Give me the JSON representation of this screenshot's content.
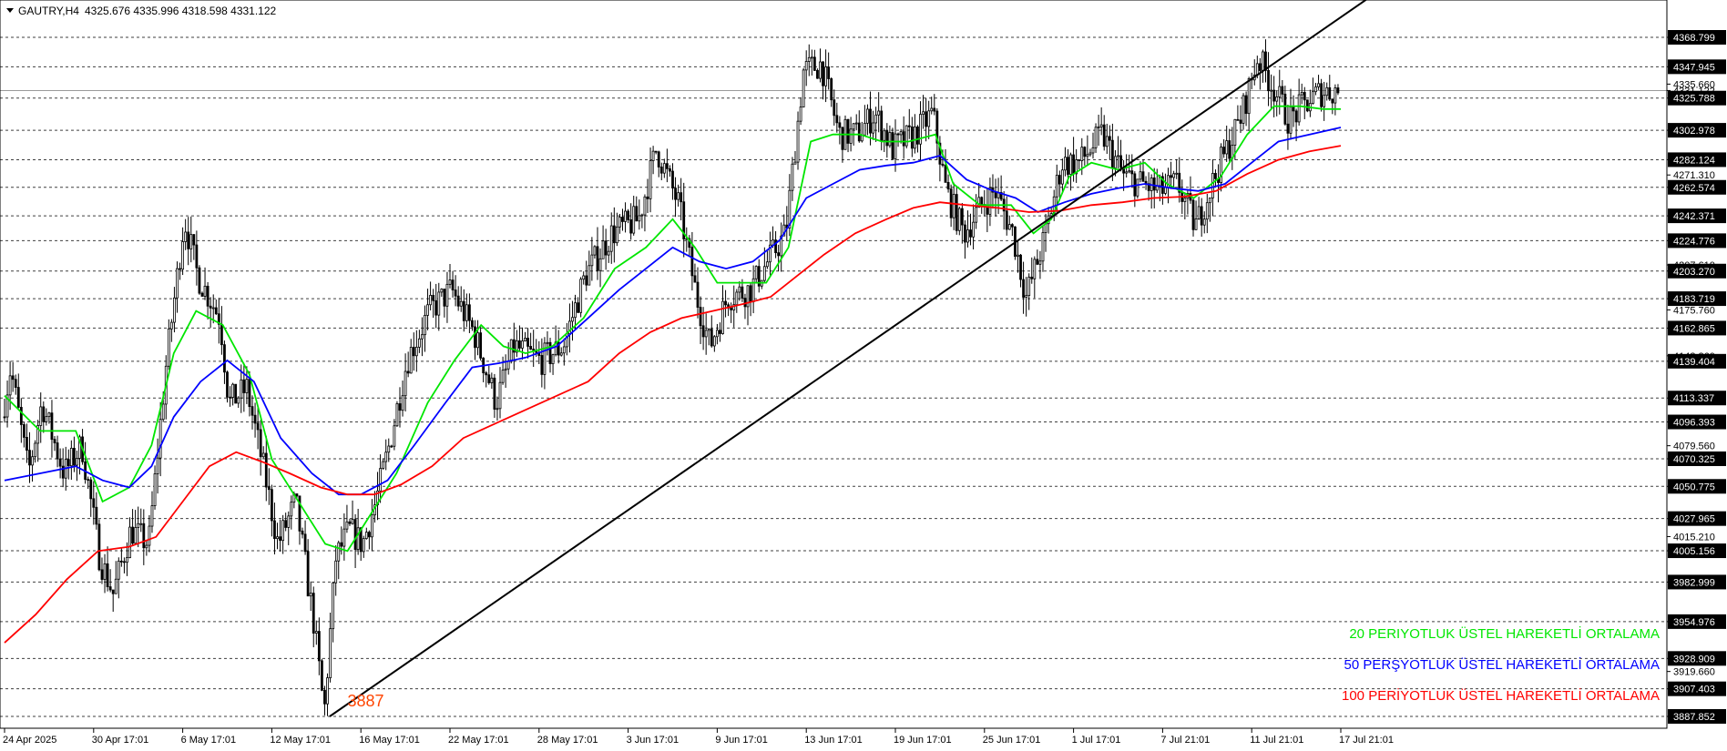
{
  "header": {
    "symbol": "GAUTRY,H4",
    "ohlc": "4325.676 4335.996 4318.598 4331.122"
  },
  "chart_data": {
    "type": "candlestick",
    "symbol": "GAUTRY",
    "timeframe": "H4",
    "ylim": [
      3880,
      4395
    ],
    "price_levels_dashed": [
      4368.799,
      4347.945,
      4325.788,
      4302.978,
      4282.124,
      4262.574,
      4242.371,
      4224.776,
      4203.27,
      4183.719,
      4162.865,
      4139.404,
      4113.337,
      4096.393,
      4070.325,
      4050.775,
      4027.965,
      4005.156,
      3982.999,
      3954.976,
      3928.909,
      3907.403,
      3887.852
    ],
    "price_levels_plain": [
      4271.31,
      4175.76,
      4079.56,
      4015.21,
      3919.66
    ],
    "price_levels_partial": [
      4335.66,
      4331.122,
      4207.61,
      4143.26
    ],
    "current_price": 4331.122,
    "dates": [
      {
        "label": "24 Apr 2025",
        "x": 0
      },
      {
        "label": "30 Apr 17:01",
        "x": 1
      },
      {
        "label": "6 May 17:01",
        "x": 2
      },
      {
        "label": "12 May 17:01",
        "x": 3
      },
      {
        "label": "16 May 17:01",
        "x": 4
      },
      {
        "label": "22 May 17:01",
        "x": 5
      },
      {
        "label": "28 May 17:01",
        "x": 6
      },
      {
        "label": "3 Jun 17:01",
        "x": 7
      },
      {
        "label": "9 Jun 17:01",
        "x": 8
      },
      {
        "label": "13 Jun 17:01",
        "x": 9
      },
      {
        "label": "19 Jun 17:01",
        "x": 10
      },
      {
        "label": "25 Jun 17:01",
        "x": 11
      },
      {
        "label": "1 Jul 17:01",
        "x": 12
      },
      {
        "label": "7 Jul 21:01",
        "x": 13
      },
      {
        "label": "11 Jul 21:01",
        "x": 14
      },
      {
        "label": "17 Jul 21:01",
        "x": 15
      }
    ],
    "price_path": [
      [
        0,
        4100
      ],
      [
        0.1,
        4135
      ],
      [
        0.3,
        4060
      ],
      [
        0.45,
        4110
      ],
      [
        0.7,
        4060
      ],
      [
        0.9,
        4080
      ],
      [
        1.1,
        4000
      ],
      [
        1.25,
        3975
      ],
      [
        1.45,
        4020
      ],
      [
        1.65,
        4010
      ],
      [
        1.85,
        4140
      ],
      [
        2.05,
        4240
      ],
      [
        2.2,
        4200
      ],
      [
        2.45,
        4170
      ],
      [
        2.55,
        4110
      ],
      [
        2.75,
        4120
      ],
      [
        2.95,
        4060
      ],
      [
        3.1,
        4010
      ],
      [
        3.3,
        4040
      ],
      [
        3.5,
        3955
      ],
      [
        3.62,
        3890
      ],
      [
        3.75,
        4000
      ],
      [
        3.9,
        4020
      ],
      [
        4.05,
        4010
      ],
      [
        4.2,
        4040
      ],
      [
        4.35,
        4080
      ],
      [
        4.55,
        4140
      ],
      [
        4.8,
        4175
      ],
      [
        5.05,
        4190
      ],
      [
        5.3,
        4160
      ],
      [
        5.55,
        4110
      ],
      [
        5.75,
        4150
      ],
      [
        6.05,
        4140
      ],
      [
        6.3,
        4150
      ],
      [
        6.55,
        4200
      ],
      [
        6.85,
        4230
      ],
      [
        7.15,
        4240
      ],
      [
        7.35,
        4290
      ],
      [
        7.6,
        4250
      ],
      [
        7.8,
        4185
      ],
      [
        7.95,
        4150
      ],
      [
        8.15,
        4185
      ],
      [
        8.4,
        4190
      ],
      [
        8.6,
        4210
      ],
      [
        8.8,
        4230
      ],
      [
        9.0,
        4345
      ],
      [
        9.2,
        4350
      ],
      [
        9.4,
        4300
      ],
      [
        9.6,
        4300
      ],
      [
        9.8,
        4315
      ],
      [
        10.0,
        4290
      ],
      [
        10.25,
        4300
      ],
      [
        10.45,
        4315
      ],
      [
        10.6,
        4260
      ],
      [
        10.8,
        4230
      ],
      [
        11.0,
        4250
      ],
      [
        11.15,
        4260
      ],
      [
        11.35,
        4230
      ],
      [
        11.5,
        4185
      ],
      [
        11.7,
        4225
      ],
      [
        11.9,
        4280
      ],
      [
        12.1,
        4280
      ],
      [
        12.35,
        4300
      ],
      [
        12.6,
        4270
      ],
      [
        12.8,
        4265
      ],
      [
        13.0,
        4260
      ],
      [
        13.2,
        4265
      ],
      [
        13.4,
        4235
      ],
      [
        13.65,
        4275
      ],
      [
        13.9,
        4310
      ],
      [
        14.1,
        4355
      ],
      [
        14.3,
        4330
      ],
      [
        14.45,
        4310
      ],
      [
        14.6,
        4320
      ],
      [
        14.8,
        4330
      ],
      [
        15.0,
        4331.122
      ]
    ],
    "moving_averages": [
      {
        "name": "20 PERIYOTLUK ÜSTEL HAREKETLİ ORTALAMA",
        "color": "#00e600",
        "points": [
          [
            0,
            4115
          ],
          [
            0.4,
            4090
          ],
          [
            0.8,
            4090
          ],
          [
            1.1,
            4040
          ],
          [
            1.4,
            4050
          ],
          [
            1.65,
            4080
          ],
          [
            1.9,
            4145
          ],
          [
            2.15,
            4175
          ],
          [
            2.45,
            4165
          ],
          [
            2.75,
            4130
          ],
          [
            3.0,
            4070
          ],
          [
            3.35,
            4035
          ],
          [
            3.6,
            4010
          ],
          [
            3.85,
            4005
          ],
          [
            4.1,
            4030
          ],
          [
            4.4,
            4060
          ],
          [
            4.75,
            4110
          ],
          [
            5.05,
            4140
          ],
          [
            5.35,
            4165
          ],
          [
            5.6,
            4150
          ],
          [
            5.85,
            4145
          ],
          [
            6.15,
            4150
          ],
          [
            6.5,
            4170
          ],
          [
            6.85,
            4205
          ],
          [
            7.2,
            4220
          ],
          [
            7.5,
            4240
          ],
          [
            7.75,
            4220
          ],
          [
            8.0,
            4195
          ],
          [
            8.3,
            4195
          ],
          [
            8.55,
            4195
          ],
          [
            8.8,
            4220
          ],
          [
            9.05,
            4295
          ],
          [
            9.3,
            4300
          ],
          [
            9.6,
            4300
          ],
          [
            9.85,
            4295
          ],
          [
            10.15,
            4295
          ],
          [
            10.45,
            4300
          ],
          [
            10.65,
            4265
          ],
          [
            10.95,
            4250
          ],
          [
            11.3,
            4250
          ],
          [
            11.55,
            4230
          ],
          [
            11.75,
            4240
          ],
          [
            11.95,
            4270
          ],
          [
            12.2,
            4280
          ],
          [
            12.5,
            4275
          ],
          [
            12.8,
            4280
          ],
          [
            13.05,
            4265
          ],
          [
            13.35,
            4255
          ],
          [
            13.65,
            4270
          ],
          [
            13.95,
            4300
          ],
          [
            14.25,
            4320
          ],
          [
            14.55,
            4320
          ],
          [
            14.8,
            4318
          ],
          [
            15.0,
            4318
          ]
        ]
      },
      {
        "name": "50 PERŞYOTLUK ÜSTEL HAREKETLİ ORTALAMA",
        "color": "#0000ff",
        "points": [
          [
            0,
            4055
          ],
          [
            0.4,
            4060
          ],
          [
            0.8,
            4065
          ],
          [
            1.1,
            4055
          ],
          [
            1.4,
            4050
          ],
          [
            1.65,
            4065
          ],
          [
            1.9,
            4100
          ],
          [
            2.2,
            4125
          ],
          [
            2.5,
            4140
          ],
          [
            2.8,
            4125
          ],
          [
            3.1,
            4085
          ],
          [
            3.45,
            4060
          ],
          [
            3.75,
            4045
          ],
          [
            4.0,
            4045
          ],
          [
            4.3,
            4055
          ],
          [
            4.6,
            4080
          ],
          [
            4.95,
            4110
          ],
          [
            5.25,
            4135
          ],
          [
            5.55,
            4138
          ],
          [
            5.85,
            4142
          ],
          [
            6.2,
            4150
          ],
          [
            6.55,
            4170
          ],
          [
            6.9,
            4190
          ],
          [
            7.2,
            4205
          ],
          [
            7.5,
            4220
          ],
          [
            7.8,
            4210
          ],
          [
            8.1,
            4205
          ],
          [
            8.4,
            4210
          ],
          [
            8.7,
            4225
          ],
          [
            9.0,
            4255
          ],
          [
            9.3,
            4265
          ],
          [
            9.6,
            4275
          ],
          [
            9.9,
            4278
          ],
          [
            10.2,
            4280
          ],
          [
            10.5,
            4285
          ],
          [
            10.8,
            4268
          ],
          [
            11.1,
            4260
          ],
          [
            11.35,
            4255
          ],
          [
            11.6,
            4245
          ],
          [
            11.9,
            4252
          ],
          [
            12.2,
            4258
          ],
          [
            12.5,
            4262
          ],
          [
            12.8,
            4265
          ],
          [
            13.1,
            4262
          ],
          [
            13.4,
            4260
          ],
          [
            13.7,
            4265
          ],
          [
            14.0,
            4280
          ],
          [
            14.3,
            4295
          ],
          [
            14.65,
            4300
          ],
          [
            15.0,
            4305
          ]
        ]
      },
      {
        "name": "100 PERİYOTLUK ÜSTEL HAREKETLİ ORTALAMA",
        "color": "#ff0000",
        "points": [
          [
            0,
            3940
          ],
          [
            0.35,
            3960
          ],
          [
            0.7,
            3985
          ],
          [
            1.05,
            4005
          ],
          [
            1.4,
            4008
          ],
          [
            1.7,
            4015
          ],
          [
            2.0,
            4040
          ],
          [
            2.3,
            4065
          ],
          [
            2.6,
            4075
          ],
          [
            2.9,
            4068
          ],
          [
            3.2,
            4060
          ],
          [
            3.55,
            4050
          ],
          [
            3.85,
            4045
          ],
          [
            4.15,
            4045
          ],
          [
            4.45,
            4052
          ],
          [
            4.8,
            4065
          ],
          [
            5.15,
            4085
          ],
          [
            5.5,
            4095
          ],
          [
            5.85,
            4105
          ],
          [
            6.2,
            4115
          ],
          [
            6.55,
            4125
          ],
          [
            6.9,
            4145
          ],
          [
            7.25,
            4160
          ],
          [
            7.6,
            4170
          ],
          [
            7.95,
            4175
          ],
          [
            8.3,
            4180
          ],
          [
            8.6,
            4185
          ],
          [
            8.9,
            4200
          ],
          [
            9.2,
            4215
          ],
          [
            9.55,
            4230
          ],
          [
            9.9,
            4240
          ],
          [
            10.2,
            4248
          ],
          [
            10.5,
            4252
          ],
          [
            10.8,
            4250
          ],
          [
            11.15,
            4248
          ],
          [
            11.5,
            4245
          ],
          [
            11.85,
            4246
          ],
          [
            12.2,
            4250
          ],
          [
            12.55,
            4252
          ],
          [
            12.9,
            4255
          ],
          [
            13.25,
            4256
          ],
          [
            13.6,
            4260
          ],
          [
            13.95,
            4272
          ],
          [
            14.3,
            4282
          ],
          [
            14.65,
            4288
          ],
          [
            15.0,
            4292
          ]
        ]
      }
    ],
    "trendline": [
      [
        3.65,
        3887.852
      ],
      [
        15.32,
        4397
      ]
    ],
    "annotations": [
      {
        "text": "3887",
        "x": 3.85,
        "y": 3895
      }
    ]
  },
  "legend": {
    "ema20": "20 PERIYOTLUK ÜSTEL HAREKETLİ ORTALAMA",
    "ema50": "50 PERŞYOTLUK ÜSTEL HAREKETLİ ORTALAMA",
    "ema100": "100 PERİYOTLUK ÜSTEL HAREKETLİ ORTALAMA"
  },
  "colors": {
    "ema20": "#00e600",
    "ema50": "#0000ff",
    "ema100": "#ff0000",
    "annotation": "#ff4500",
    "trendline": "#000000",
    "candles": "#000000"
  }
}
